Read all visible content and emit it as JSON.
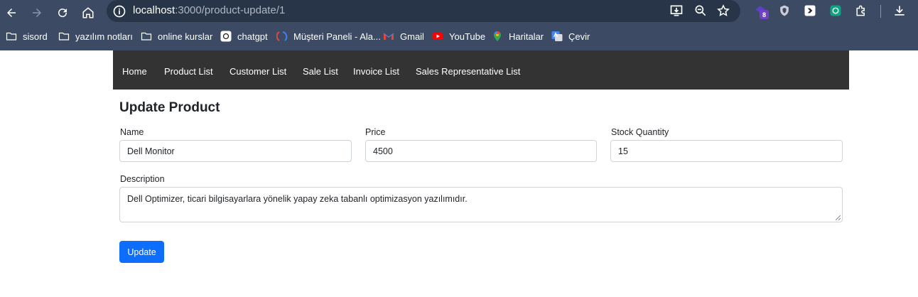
{
  "browser": {
    "url_host": "localhost",
    "url_rest": ":3000/product-update/1",
    "extension_badge": "8",
    "bookmarks": [
      {
        "label": "sisord",
        "icon": "folder-icon"
      },
      {
        "label": "yazılım notları",
        "icon": "folder-icon"
      },
      {
        "label": "online kurslar",
        "icon": "folder-icon"
      },
      {
        "label": "chatgpt",
        "icon": "chatgpt-icon"
      },
      {
        "label": "Müşteri Paneli - Ala...",
        "icon": "customer-panel-icon"
      },
      {
        "label": "Gmail",
        "icon": "gmail-icon"
      },
      {
        "label": "YouTube",
        "icon": "youtube-icon"
      },
      {
        "label": "Haritalar",
        "icon": "maps-icon"
      },
      {
        "label": "Çevir",
        "icon": "translate-icon"
      }
    ]
  },
  "navbar": {
    "items": [
      "Home",
      "Product List",
      "Customer List",
      "Sale List",
      "Invoice List",
      "Sales Representative List"
    ]
  },
  "form": {
    "title": "Update Product",
    "name_label": "Name",
    "name_value": "Dell Monitor",
    "price_label": "Price",
    "price_value": "4500",
    "stock_label": "Stock Quantity",
    "stock_value": "15",
    "description_label": "Description",
    "description_value": "Dell Optimizer, ticari bilgisayarlara yönelik yapay zeka tabanlı optimizasyon yazılımıdır.",
    "submit_label": "Update"
  },
  "colors": {
    "chrome_bg": "#3c4a63",
    "navbar_bg": "#333333",
    "button_primary": "#0d6efd"
  }
}
